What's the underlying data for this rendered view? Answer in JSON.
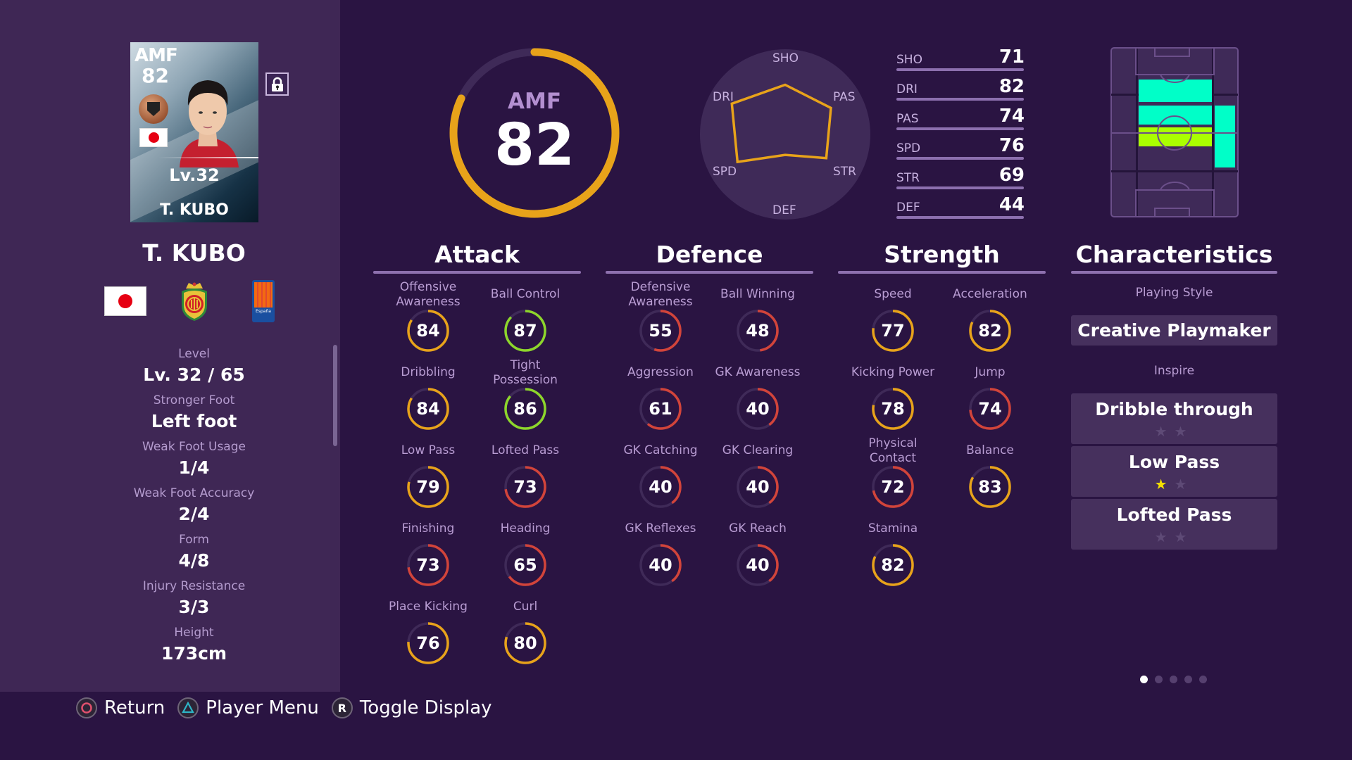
{
  "card": {
    "position": "AMF",
    "overall": "82",
    "level": "Lv.32",
    "name": "T. KUBO",
    "nationality_flag": "japan-flag-icon"
  },
  "player": {
    "name": "T. KUBO",
    "badges": [
      "japan-flag-icon",
      "club-crest-icon",
      "league-badge-icon"
    ],
    "league_badge_text": "España"
  },
  "info": [
    {
      "label": "Level",
      "value": "Lv. 32 / 65"
    },
    {
      "label": "Stronger Foot",
      "value": "Left foot"
    },
    {
      "label": "Weak Foot Usage",
      "value": "1/4"
    },
    {
      "label": "Weak Foot Accuracy",
      "value": "2/4"
    },
    {
      "label": "Form",
      "value": "4/8"
    },
    {
      "label": "Injury Resistance",
      "value": "3/3"
    },
    {
      "label": "Height",
      "value": "173cm"
    }
  ],
  "overview": {
    "position": "AMF",
    "overall": "82",
    "overall_fraction": 0.82
  },
  "radar": {
    "axes": [
      "SHO",
      "PAS",
      "STR",
      "DEF",
      "SPD",
      "DRI"
    ],
    "values": [
      71,
      74,
      69,
      44,
      76,
      82
    ]
  },
  "stat_bars": [
    {
      "label": "SHO",
      "value": "71"
    },
    {
      "label": "DRI",
      "value": "82"
    },
    {
      "label": "PAS",
      "value": "74"
    },
    {
      "label": "SPD",
      "value": "76"
    },
    {
      "label": "STR",
      "value": "69"
    },
    {
      "label": "DEF",
      "value": "44"
    }
  ],
  "colors": {
    "ring_high": "#8dd62b",
    "ring_mid": "#e8a31a",
    "ring_low": "#d2443a",
    "ring_track": "#3f2a58",
    "pitch_main": "#00ffc8",
    "pitch_secondary": "#aaff00"
  },
  "sections": {
    "attack": {
      "title": "Attack",
      "stats": [
        {
          "label": "Offensive Awareness",
          "value": 84
        },
        {
          "label": "Ball Control",
          "value": 87
        },
        {
          "label": "Dribbling",
          "value": 84
        },
        {
          "label": "Tight Possession",
          "value": 86
        },
        {
          "label": "Low Pass",
          "value": 79
        },
        {
          "label": "Lofted Pass",
          "value": 73
        },
        {
          "label": "Finishing",
          "value": 73
        },
        {
          "label": "Heading",
          "value": 65
        },
        {
          "label": "Place Kicking",
          "value": 76
        },
        {
          "label": "Curl",
          "value": 80
        }
      ]
    },
    "defence": {
      "title": "Defence",
      "stats": [
        {
          "label": "Defensive Awareness",
          "value": 55
        },
        {
          "label": "Ball Winning",
          "value": 48
        },
        {
          "label": "Aggression",
          "value": 61
        },
        {
          "label": "GK Awareness",
          "value": 40
        },
        {
          "label": "GK Catching",
          "value": 40
        },
        {
          "label": "GK Clearing",
          "value": 40
        },
        {
          "label": "GK Reflexes",
          "value": 40
        },
        {
          "label": "GK Reach",
          "value": 40
        }
      ]
    },
    "strength": {
      "title": "Strength",
      "stats": [
        {
          "label": "Speed",
          "value": 77
        },
        {
          "label": "Acceleration",
          "value": 82
        },
        {
          "label": "Kicking Power",
          "value": 78
        },
        {
          "label": "Jump",
          "value": 74
        },
        {
          "label": "Physical Contact",
          "value": 72
        },
        {
          "label": "Balance",
          "value": 83
        },
        {
          "label": "Stamina",
          "value": 82
        }
      ]
    },
    "characteristics": {
      "title": "Characteristics",
      "playing_style_label": "Playing Style",
      "playing_style": "Creative Playmaker",
      "inspire_label": "Inspire",
      "inspire": [
        {
          "name": "Dribble through",
          "stars": 0,
          "max_stars": 2
        },
        {
          "name": "Low Pass",
          "stars": 1,
          "max_stars": 2
        },
        {
          "name": "Lofted Pass",
          "stars": 0,
          "max_stars": 2
        }
      ]
    }
  },
  "pitch_positions": [
    {
      "zone": "AMF",
      "level": "main"
    },
    {
      "zone": "CMF",
      "level": "main"
    },
    {
      "zone": "DMF-upper",
      "level": "secondary"
    },
    {
      "zone": "RMF",
      "level": "main"
    }
  ],
  "footer": {
    "hints": [
      {
        "button": "circle",
        "label": "Return"
      },
      {
        "button": "triangle",
        "label": "Player Menu"
      },
      {
        "button": "R",
        "label": "Toggle Display"
      }
    ]
  },
  "pagination": {
    "current": 1,
    "total": 5
  }
}
